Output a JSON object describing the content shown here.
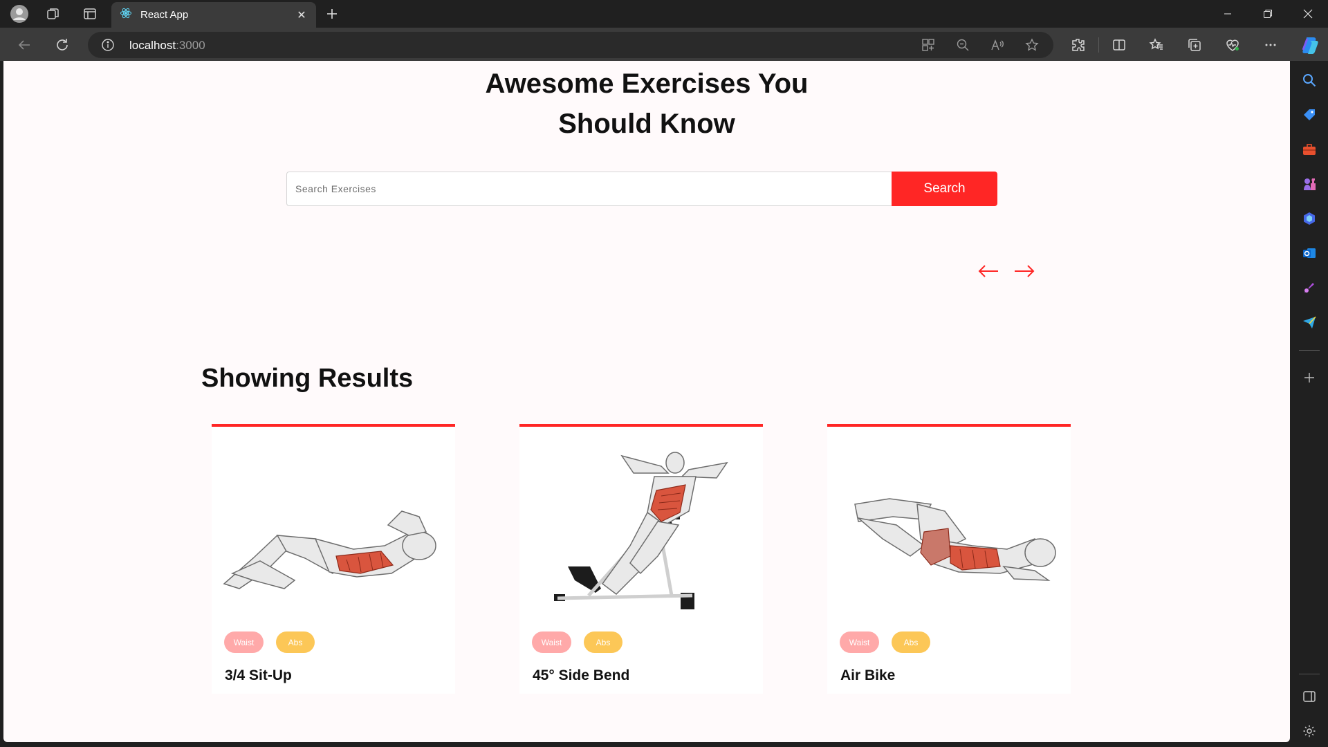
{
  "browser": {
    "tab_title": "React App",
    "url_host": "localhost",
    "url_port": ":3000"
  },
  "page": {
    "hero_title_line1": "Awesome Exercises You",
    "hero_title_line2": "Should Know",
    "search_placeholder": "Search Exercises",
    "search_button": "Search",
    "results_title": "Showing Results",
    "accent_color": "#ff2625",
    "exercises": [
      {
        "name": "3/4 Sit-Up",
        "body_part": "Waist",
        "target": "Abs"
      },
      {
        "name": "45° Side Bend",
        "body_part": "Waist",
        "target": "Abs"
      },
      {
        "name": "Air Bike",
        "body_part": "Waist",
        "target": "Abs"
      }
    ]
  }
}
